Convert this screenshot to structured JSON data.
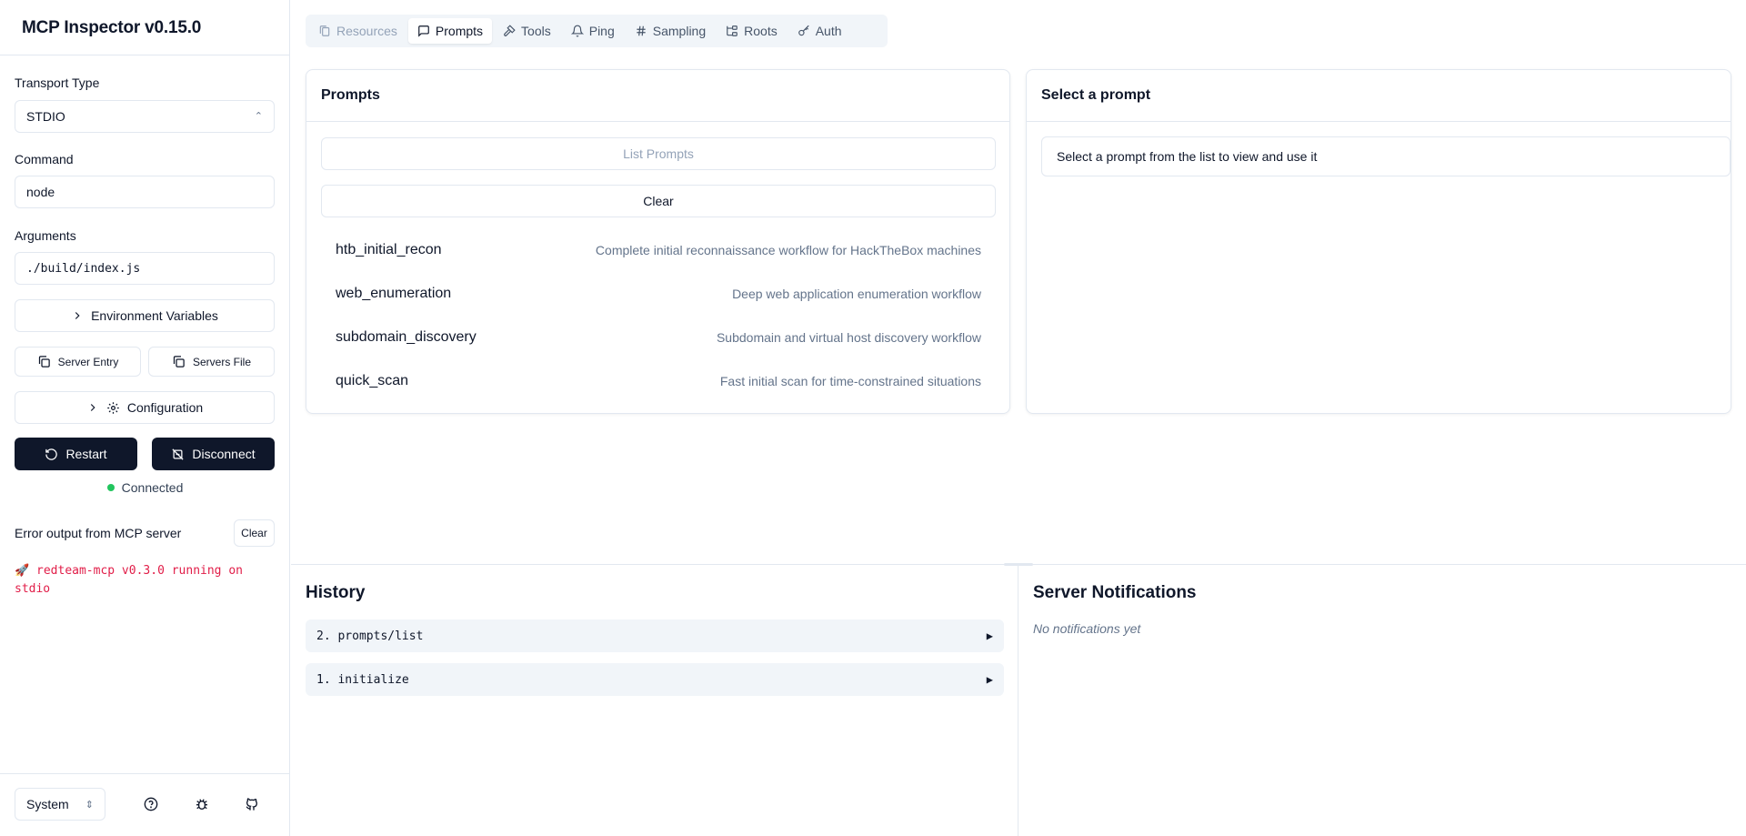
{
  "app": {
    "title": "MCP Inspector v0.15.0"
  },
  "sidebar": {
    "transport_label": "Transport Type",
    "transport_value": "STDIO",
    "command_label": "Command",
    "command_value": "node",
    "arguments_label": "Arguments",
    "arguments_value": "./build/index.js",
    "env_label": "Environment Variables",
    "server_entry_label": "Server Entry",
    "servers_file_label": "Servers File",
    "config_label": "Configuration",
    "restart_label": "Restart",
    "disconnect_label": "Disconnect",
    "status_text": "Connected",
    "status_color": "#22c55e",
    "error_title": "Error output from MCP server",
    "error_clear": "Clear",
    "error_log": "redteam-mcp v0.3.0 running on stdio",
    "theme_value": "System"
  },
  "tabs": [
    {
      "label": "Resources",
      "icon": "files-icon",
      "state": "disabled"
    },
    {
      "label": "Prompts",
      "icon": "message-square-icon",
      "state": "active"
    },
    {
      "label": "Tools",
      "icon": "hammer-icon",
      "state": "normal"
    },
    {
      "label": "Ping",
      "icon": "bell-icon",
      "state": "normal"
    },
    {
      "label": "Sampling",
      "icon": "hash-icon",
      "state": "normal"
    },
    {
      "label": "Roots",
      "icon": "folder-tree-icon",
      "state": "normal"
    },
    {
      "label": "Auth",
      "icon": "key-icon",
      "state": "normal"
    }
  ],
  "prompts_panel": {
    "title": "Prompts",
    "list_button": "List Prompts",
    "clear_button": "Clear",
    "items": [
      {
        "name": "htb_initial_recon",
        "description": "Complete initial reconnaissance workflow for HackTheBox machines"
      },
      {
        "name": "web_enumeration",
        "description": "Deep web application enumeration workflow"
      },
      {
        "name": "subdomain_discovery",
        "description": "Subdomain and virtual host discovery workflow"
      },
      {
        "name": "quick_scan",
        "description": "Fast initial scan for time-constrained situations"
      }
    ]
  },
  "detail_panel": {
    "title": "Select a prompt",
    "hint": "Select a prompt from the list to view and use it"
  },
  "history": {
    "title": "History",
    "items": [
      "2. prompts/list",
      "1. initialize"
    ]
  },
  "notifications": {
    "title": "Server Notifications",
    "empty": "No notifications yet"
  },
  "colors": {
    "primary_dark": "#0f172a",
    "border": "#e2e8f0",
    "error_text": "#e11d48"
  }
}
